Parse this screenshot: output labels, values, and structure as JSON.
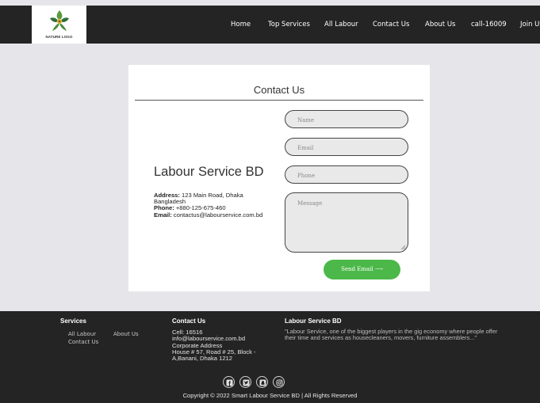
{
  "header": {
    "logo_text": "NATURE LOGO",
    "nav": [
      "Home",
      "Top Services",
      "All Labour",
      "Contact Us",
      "About Us",
      "call-16009",
      "Join Us"
    ]
  },
  "contact": {
    "title": "Contact Us",
    "company": "Labour Service BD",
    "address_label": "Address:",
    "address_line1": "123 Main Road, Dhaka",
    "address_line2": "Bangladesh",
    "phone_label": "Phone:",
    "phone_value": "+880-125-675-460",
    "email_label": "Email:",
    "email_value": "contactus@labourservice.com.bd",
    "form": {
      "name_placeholder": "Name",
      "email_placeholder": "Email",
      "phone_placeholder": "Phone",
      "message_placeholder": "Message",
      "send_label": "Send Email ⟶"
    }
  },
  "footer": {
    "services_title": "Services",
    "services_links": [
      "All Labour",
      "About Us",
      "Contact Us"
    ],
    "contact_title": "Contact Us",
    "contact_lines": [
      "Cell: 16516",
      "info@labourservice.com.bd",
      "Corporate Address",
      "House # 57, Road # 25, Block -",
      "A,Banani, Dhaka 1212"
    ],
    "about_title": "Labour Service BD",
    "about_text": "\"Labour Service, one of the biggest players in the gig economy where people offer their time and services as housecleaners, movers, furniture assemblers...\"",
    "social_icons": [
      "facebook-icon",
      "twitter-icon",
      "snapchat-icon",
      "instagram-icon"
    ],
    "copyright": "Copyright © 2022 Smart Labour Service BD | All Rights Reserved"
  },
  "colors": {
    "header_bg": "#242424",
    "page_bg": "#e6e6ea",
    "accent_green": "#4cb849",
    "field_bg": "#e9e9e9"
  }
}
